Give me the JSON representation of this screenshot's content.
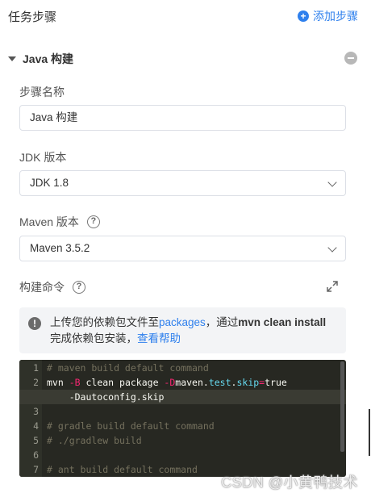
{
  "header": {
    "title": "任务步骤",
    "add_step_label": "添加步骤"
  },
  "step": {
    "title": "Java 构建"
  },
  "form": {
    "step_name_label": "步骤名称",
    "step_name_value": "Java 构建",
    "jdk_label": "JDK 版本",
    "jdk_value": "JDK 1.8",
    "maven_label": "Maven 版本",
    "maven_value": "Maven 3.5.2",
    "build_cmd_label": "构建命令"
  },
  "notice": {
    "part1": "上传您的依赖包文件至",
    "packages_link": "packages",
    "part2": "，通过",
    "command": "mvn clean install",
    "part3": "完成依赖包安装，",
    "help_link": "查看帮助"
  },
  "editor": {
    "lines": [
      {
        "no": "1",
        "text": "# maven build default command"
      },
      {
        "no": "2",
        "text": "mvn -B clean package -Dmaven.test.skip=true"
      },
      {
        "no": "",
        "text": "    -Dautoconfig.skip"
      },
      {
        "no": "3",
        "text": ""
      },
      {
        "no": "4",
        "text": "# gradle build default command"
      },
      {
        "no": "5",
        "text": "# ./gradlew build"
      },
      {
        "no": "6",
        "text": ""
      },
      {
        "no": "7",
        "text": "# ant build default command"
      }
    ]
  },
  "watermark": "CSDN @小黄鸭技术",
  "colors": {
    "accent": "#2f80ed",
    "editor_bg": "#272822"
  },
  "icons": {
    "add": "plus-circle-icon",
    "remove": "minus-circle-icon",
    "help": "question-circle-icon",
    "info": "info-circle-icon",
    "expand": "expand-icon"
  }
}
